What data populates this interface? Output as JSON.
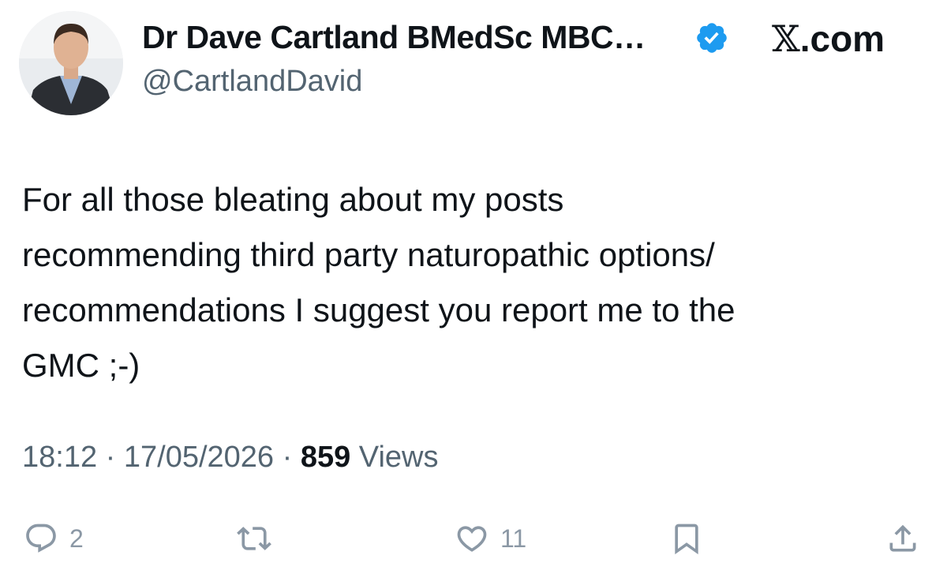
{
  "author": {
    "display_name": "Dr Dave Cartland BMedSc MBC…",
    "handle": "@CartlandDavid",
    "verified": true,
    "avatar": "profile-photo"
  },
  "source_label": {
    "glyph": "𝕏",
    "suffix": ".com"
  },
  "tweet": {
    "text": "For all those bleating about my posts\nrecommending third party naturopathic options/\nrecommendations I suggest you report me to the\nGMC ;-)"
  },
  "meta": {
    "time": "18:12",
    "separator_1": " · ",
    "date": "17/05/2026",
    "separator_2": " · ",
    "views_count": "859",
    "views_label": " Views"
  },
  "actions": {
    "reply": {
      "icon": "reply-icon",
      "count": "2"
    },
    "repost": {
      "icon": "repost-icon",
      "count": ""
    },
    "like": {
      "icon": "heart-icon",
      "count": "11"
    },
    "bookmark": {
      "icon": "bookmark-icon",
      "count": ""
    },
    "share": {
      "icon": "share-icon",
      "count": ""
    }
  },
  "colors": {
    "text_primary": "#0f1419",
    "text_secondary": "#536471",
    "icon_muted": "#8b98a5",
    "verified_blue": "#1d9bf0"
  }
}
